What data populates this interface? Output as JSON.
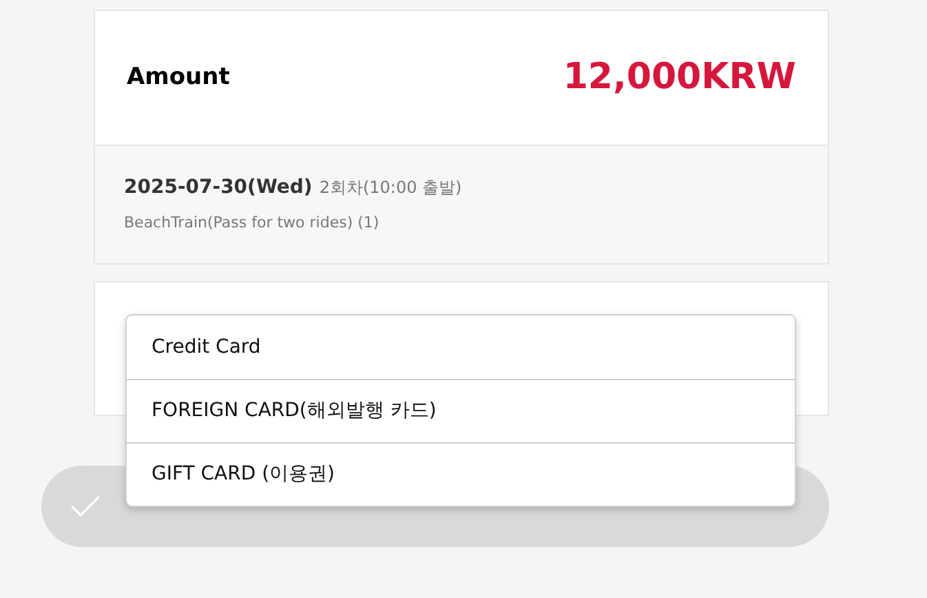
{
  "amount": {
    "label": "Amount",
    "value": "12,000KRW"
  },
  "booking": {
    "date": "2025-07-30(Wed)",
    "session": "2회차(10:00 출발)",
    "product": "BeachTrain(Pass for two rides) (1)"
  },
  "payment_menu": {
    "options": [
      "Credit Card",
      "FOREIGN CARD(해외발행 카드)",
      "GIFT CARD (이용권)"
    ]
  },
  "buy_button": {
    "disabled": true
  }
}
